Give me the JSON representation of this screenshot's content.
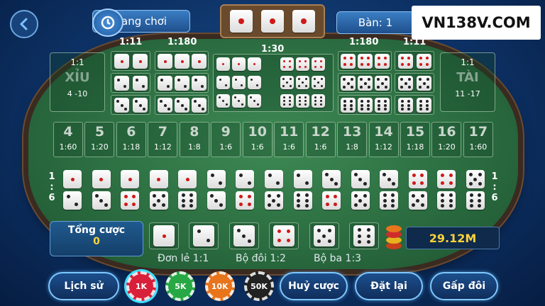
{
  "header": {
    "room_label": "ang chơi",
    "table_label": "Bàn: 1",
    "brand": "VN138V.COM",
    "result_dice": [
      1,
      1,
      1
    ]
  },
  "board": {
    "small": {
      "ratio": "1:1",
      "title": "XỈU",
      "range": "4 -10"
    },
    "big": {
      "ratio": "1:1",
      "title": "TÀI",
      "range": "11 -17"
    },
    "group_ratios": [
      "1:11",
      "1:180",
      "1:30",
      "1:180",
      "1:11"
    ],
    "sums": [
      {
        "n": "4",
        "odds": "1:60"
      },
      {
        "n": "5",
        "odds": "1:20"
      },
      {
        "n": "6",
        "odds": "1:18"
      },
      {
        "n": "7",
        "odds": "1:12"
      },
      {
        "n": "8",
        "odds": "1:8"
      },
      {
        "n": "9",
        "odds": "1:6"
      },
      {
        "n": "10",
        "odds": "1:6"
      },
      {
        "n": "11",
        "odds": "1:6"
      },
      {
        "n": "12",
        "odds": "1:6"
      },
      {
        "n": "13",
        "odds": "1:8"
      },
      {
        "n": "14",
        "odds": "1:12"
      },
      {
        "n": "15",
        "odds": "1:18"
      },
      {
        "n": "16",
        "odds": "1:20"
      },
      {
        "n": "17",
        "odds": "1:60"
      }
    ],
    "pair_ratio_left": [
      "1",
      ":",
      "6"
    ],
    "pair_ratio_right": [
      "1",
      ":",
      "6"
    ]
  },
  "bottom": {
    "total_label": "Tổng cược",
    "total_value": "0",
    "single_dice": [
      1,
      2,
      3,
      4,
      5,
      6
    ],
    "balance": "29.12M",
    "legend_single": "Đơn lẻ 1:1",
    "legend_double": "Bộ đôi 1:2",
    "legend_triple": "Bộ ba 1:3"
  },
  "toolbar": {
    "history": "Lịch sử",
    "cancel": "Huỷ cược",
    "reset": "Đặt lại",
    "double": "Gấp đôi",
    "chips": [
      {
        "label": "1K",
        "color": "#d8203a"
      },
      {
        "label": "5K",
        "color": "#27a844"
      },
      {
        "label": "10K",
        "color": "#e8741c"
      },
      {
        "label": "50K",
        "color": "#222222"
      }
    ]
  }
}
